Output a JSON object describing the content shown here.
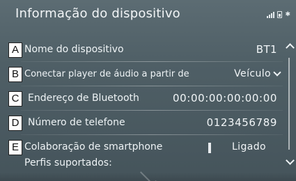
{
  "header": {
    "title": "Informação do dispositivo",
    "status_icons": [
      "signal-icon",
      "battery-icon",
      "bluetooth-icon"
    ]
  },
  "rows": [
    {
      "marker": "A",
      "label": "Nome do dispositivo",
      "value": "BT1"
    },
    {
      "marker": "B",
      "label": "Conectar player de áudio a partir de",
      "value": "Veículo"
    },
    {
      "marker": "C",
      "label": "Endereço de Bluetooth",
      "value": "00:00:00:00:00:00"
    },
    {
      "marker": "D",
      "label": "Número de telefone",
      "value": "0123456789"
    },
    {
      "marker": "E",
      "label": "Colaboração de smartphone",
      "value": "Ligado"
    }
  ],
  "profiles": {
    "label": "Perfis suportados:"
  }
}
